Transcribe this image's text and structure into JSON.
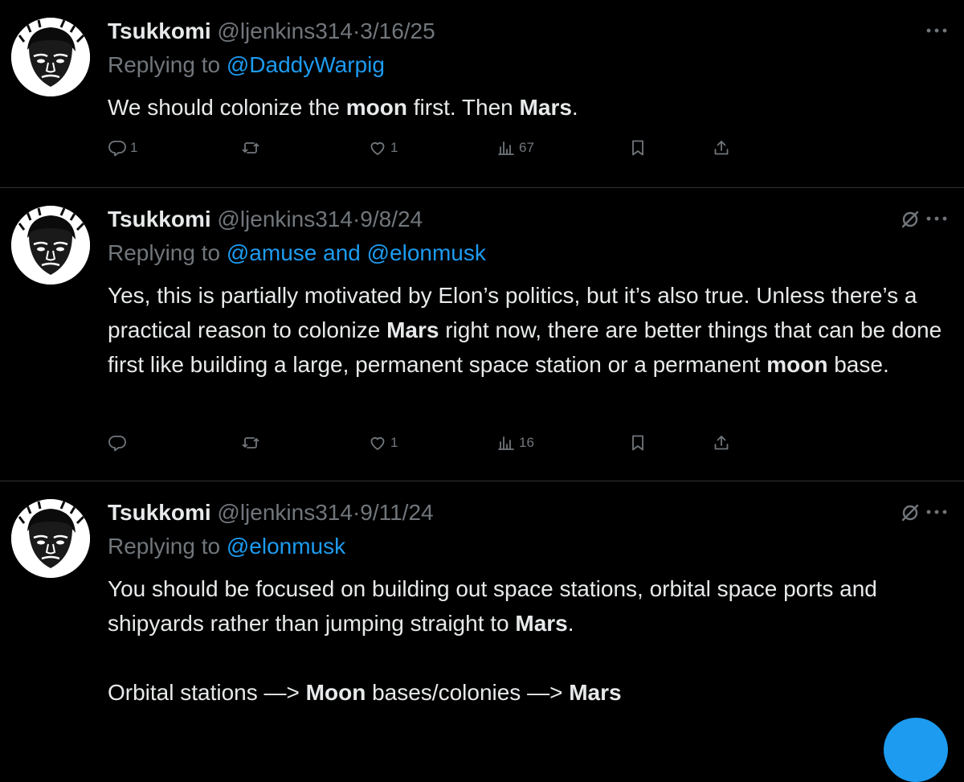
{
  "tweets": [
    {
      "author": "Tsukkomi",
      "handle": "@ljenkins314",
      "separator": "·",
      "date": "3/16/25",
      "replying_prefix": "Replying to",
      "replying_to": "@DaddyWarpig",
      "body": [
        [
          {
            "t": "We should colonize the "
          },
          {
            "t": "moon",
            "b": true
          },
          {
            "t": " first. Then "
          },
          {
            "t": "Mars",
            "b": true
          },
          {
            "t": "."
          }
        ]
      ],
      "actions": {
        "reply_count": "1",
        "retweet_count": "",
        "like_count": "1",
        "view_count": "67"
      },
      "grok_icon": false
    },
    {
      "author": "Tsukkomi",
      "handle": "@ljenkins314",
      "separator": "·",
      "date": "9/8/24",
      "replying_prefix": "Replying to",
      "replying_to": "@amuse and @elonmusk",
      "body": [
        [
          {
            "t": "Yes, this is partially motivated by Elon’s politics, but it’s also true. Unless there’s a practical reason to colonize "
          },
          {
            "t": "Mars",
            "b": true
          },
          {
            "t": " right now, there are better things that can be done first like building a large, permanent space station or a permanent "
          },
          {
            "t": "moon",
            "b": true
          },
          {
            "t": " base."
          }
        ]
      ],
      "actions": {
        "reply_count": "",
        "retweet_count": "",
        "like_count": "1",
        "view_count": "16"
      },
      "grok_icon": true
    },
    {
      "author": "Tsukkomi",
      "handle": "@ljenkins314",
      "separator": "·",
      "date": "9/11/24",
      "replying_prefix": "Replying to",
      "replying_to": "@elonmusk",
      "body": [
        [
          {
            "t": "You should be focused on building out space stations, orbital space ports and shipyards rather than jumping straight to "
          },
          {
            "t": "Mars",
            "b": true
          },
          {
            "t": "."
          }
        ],
        [],
        [
          {
            "t": "Orbital stations —> "
          },
          {
            "t": "Moon",
            "b": true
          },
          {
            "t": " bases/colonies —> "
          },
          {
            "t": "Mars",
            "b": true
          }
        ]
      ],
      "actions": null,
      "grok_icon": true
    }
  ],
  "icons": {
    "reply": "reply-bubble-icon",
    "retweet": "retweet-icon",
    "like": "heart-icon",
    "views": "views-bar-icon",
    "bookmark": "bookmark-icon",
    "share": "share-icon",
    "more": "more-dots-icon",
    "grok": "grok-slash-icon"
  },
  "colors": {
    "background": "#000000",
    "text": "#e7e9ea",
    "muted": "#71767b",
    "mention": "#1d9bf0",
    "divider": "#2f3336"
  }
}
